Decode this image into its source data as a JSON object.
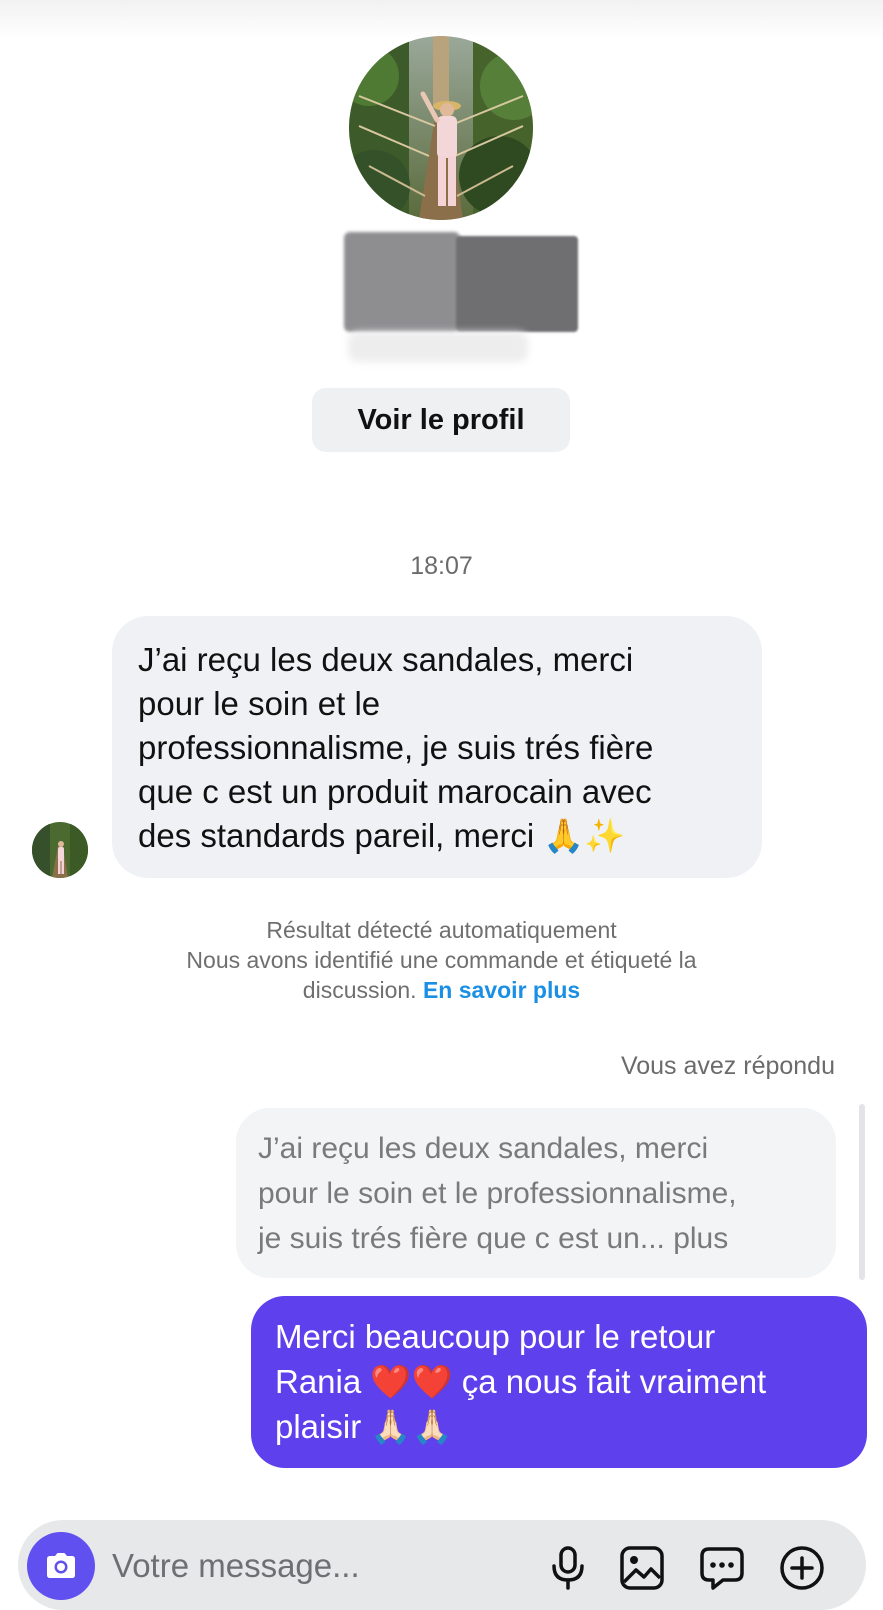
{
  "profile": {
    "view_profile_label": "Voir le profil"
  },
  "conversation": {
    "timestamp": "18:07",
    "incoming_message": {
      "lines": [
        "J’ai reçu les deux sandales, merci",
        "pour le soin et le",
        "professionnalisme, je suis trés fière",
        "que c est un produit marocain avec",
        "des standards pareil, merci 🙏✨"
      ]
    },
    "system_notice": {
      "title": "Résultat détecté automatiquement",
      "body_line1": "Nous avons identifié une commande et étiqueté la",
      "body_line2": "discussion.",
      "link_label": "En savoir plus"
    },
    "reply_label": "Vous avez répondu",
    "quoted_message": {
      "lines": [
        "J’ai reçu les deux sandales, merci",
        "pour le soin et le professionnalisme,",
        "je suis trés fière que c est un... plus"
      ]
    },
    "outgoing_message": {
      "lines": [
        "Merci beaucoup pour le retour",
        "Rania ❤️❤️ ça nous fait vraiment",
        "plaisir 🙏🏻🙏🏻"
      ]
    }
  },
  "composer": {
    "placeholder": "Votre message..."
  },
  "colors": {
    "outgoing_bubble": "#5e41ec",
    "incoming_bubble": "#eff1f4",
    "link": "#1a8fe3",
    "camera_button": "#6150f0"
  },
  "icons": [
    "camera-icon",
    "microphone-icon",
    "gallery-icon",
    "chat-bubble-icon",
    "plus-circle-icon"
  ]
}
